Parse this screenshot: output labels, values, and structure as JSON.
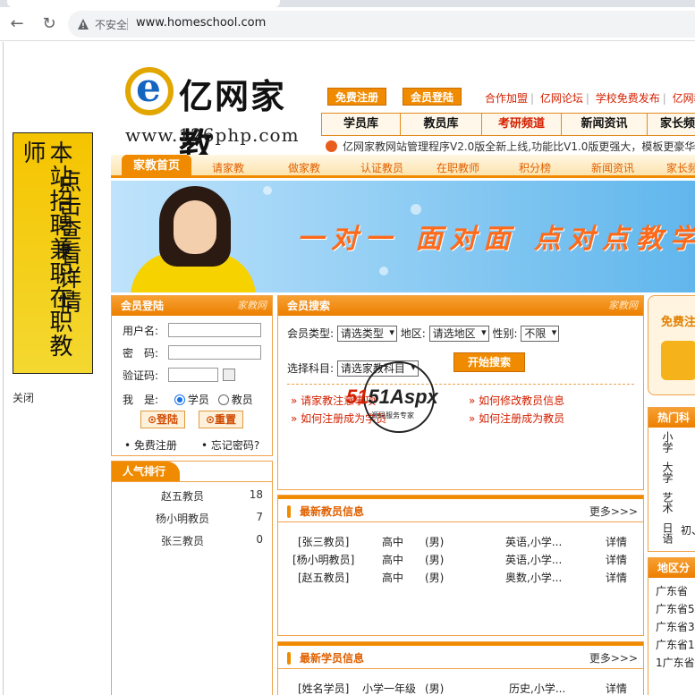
{
  "browser": {
    "security_label": "不安全",
    "url": "www.homeschool.com"
  },
  "side_ad": {
    "col1": "本站招聘兼职在职教师",
    "col2": "点击查看详情",
    "close": "关闭"
  },
  "header": {
    "logo_brand": "亿网家教",
    "logo_url": "www.126php.com",
    "btn_register": "免费注册",
    "btn_login": "会员登陆",
    "top_links": [
      "合作加盟",
      "亿网论坛",
      "学校免费发布",
      "亿网教"
    ],
    "nav": [
      {
        "label": "学员库",
        "highlight": false
      },
      {
        "label": "教员库",
        "highlight": false
      },
      {
        "label": "考研频道",
        "highlight": true
      },
      {
        "label": "新闻资讯",
        "highlight": false
      },
      {
        "label": "家长频道",
        "highlight": false
      }
    ],
    "ticker": "亿网家教网站管理程序V2.0版全新上线,功能比V1.0版更强大，模板更豪华!"
  },
  "mainnav": {
    "home": "家教首页",
    "items": [
      "请家教",
      "做家教",
      "认证教员",
      "在职教师",
      "积分榜",
      "新闻资讯",
      "家长频"
    ]
  },
  "banner": {
    "slogan": "一对一  面对面  点对点教学"
  },
  "login": {
    "title": "会员登陆",
    "watermark": "家教网",
    "username_label": "用户名:",
    "password_label": "密　码:",
    "captcha_label": "验证码:",
    "role_label": "我　是:",
    "role_student": "学员",
    "role_teacher": "教员",
    "login_btn": "登陆",
    "reset_btn": "重置",
    "register_link": "免费注册",
    "forgot_link": "忘记密码?"
  },
  "hot": {
    "title": "人气排行",
    "rows": [
      {
        "name": "赵五教员",
        "count": "18"
      },
      {
        "name": "杨小明教员",
        "count": "7"
      },
      {
        "name": "张三教员",
        "count": "0"
      }
    ]
  },
  "search": {
    "title": "会员搜索",
    "watermark": "家教网",
    "type_label": "会员类型:",
    "type_value": "请选类型",
    "region_label": "地区:",
    "region_value": "请选地区",
    "gender_label": "性别:",
    "gender_value": "不限",
    "subject_label": "选择科目:",
    "subject_value": "请选家教科目",
    "search_btn": "开始搜索",
    "links": [
      "请家教注意事项",
      "如何修改教员信息",
      "如何注册成为学员",
      "如何注册成为教员"
    ],
    "stamp_text": "51Aspx",
    "stamp_sub": "源码服务专家"
  },
  "teachers": {
    "title": "最新教员信息",
    "more": "更多>>>",
    "rows": [
      {
        "name": "[张三教员]",
        "level": "高中",
        "gender": "(男)",
        "subjects": "英语,小学...",
        "detail": "详情"
      },
      {
        "name": "[杨小明教员]",
        "level": "高中",
        "gender": "(男)",
        "subjects": "英语,小学...",
        "detail": "详情"
      },
      {
        "name": "[赵五教员]",
        "level": "高中",
        "gender": "(男)",
        "subjects": "奥数,小学...",
        "detail": "详情"
      }
    ]
  },
  "students": {
    "title": "最新学员信息",
    "more": "更多>>>",
    "rows": [
      {
        "name": "[姓名学员]",
        "level": "小学一年级",
        "gender": "(男)",
        "subjects": "历史,小学...",
        "detail": "详情"
      }
    ]
  },
  "right": {
    "free_title": "免费注",
    "hot_subjects_title": "热门科",
    "hot_subjects": [
      "小学",
      "大学",
      "艺术",
      "日语"
    ],
    "hot_subjects_extra": "初、",
    "regions_title": "地区分",
    "regions": [
      "广东省",
      "广东省5",
      "广东省3",
      "广东省1",
      "1广东省"
    ]
  },
  "colors": {
    "accent": "#f08b00",
    "link_red": "#d42000"
  }
}
